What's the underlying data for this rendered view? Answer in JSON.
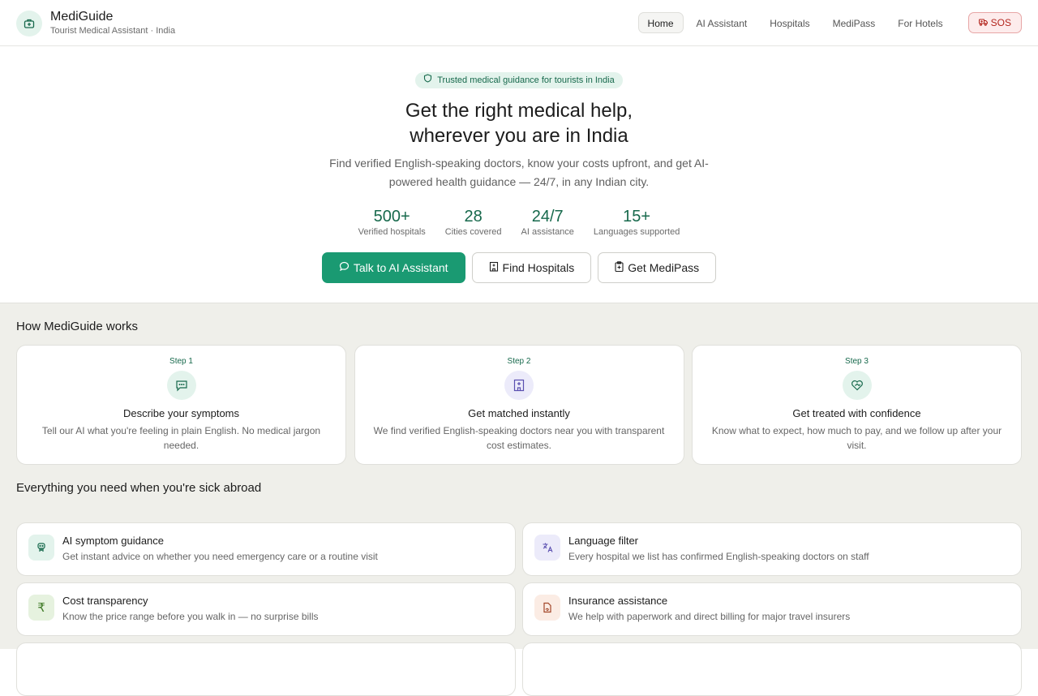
{
  "app": {
    "name": "MediGuide",
    "tagline": "Tourist Medical Assistant · India"
  },
  "nav": {
    "items": [
      {
        "label": "Home",
        "active": true
      },
      {
        "label": "AI Assistant",
        "active": false
      },
      {
        "label": "Hospitals",
        "active": false
      },
      {
        "label": "MediPass",
        "active": false
      },
      {
        "label": "For Hotels",
        "active": false
      }
    ],
    "sos_label": "SOS"
  },
  "hero": {
    "badge": "Trusted medical guidance for tourists in India",
    "title_line1": "Get the right medical help,",
    "title_line2": "wherever you are in India",
    "subtitle": "Find verified English-speaking doctors, know your costs upfront, and get AI-powered health guidance — 24/7, in any Indian city.",
    "stats": [
      {
        "value": "500+",
        "label": "Verified hospitals"
      },
      {
        "value": "28",
        "label": "Cities covered"
      },
      {
        "value": "24/7",
        "label": "AI assistance"
      },
      {
        "value": "15+",
        "label": "Languages supported"
      }
    ],
    "buttons": {
      "ai": "Talk to AI Assistant",
      "hospitals": "Find Hospitals",
      "medipass": "Get MediPass"
    }
  },
  "how": {
    "title": "How MediGuide works",
    "steps": [
      {
        "num": "Step 1",
        "title": "Describe your symptoms",
        "desc": "Tell our AI what you're feeling in plain English. No medical jargon needed.",
        "icon": "chat-icon"
      },
      {
        "num": "Step 2",
        "title": "Get matched instantly",
        "desc": "We find verified English-speaking doctors near you with transparent cost estimates.",
        "icon": "hospital-icon"
      },
      {
        "num": "Step 3",
        "title": "Get treated with confidence",
        "desc": "Know what to expect, how much to pay, and we follow up after your visit.",
        "icon": "heart-handshake-icon"
      }
    ]
  },
  "features": {
    "title": "Everything you need when you're sick abroad",
    "items": [
      {
        "title": "AI symptom guidance",
        "desc": "Get instant advice on whether you need emergency care or a routine visit",
        "icon": "stethoscope-icon"
      },
      {
        "title": "Language filter",
        "desc": "Every hospital we list has confirmed English-speaking doctors on staff",
        "icon": "translate-icon"
      },
      {
        "title": "Cost transparency",
        "desc": "Know the price range before you walk in — no surprise bills",
        "icon": "rupee-icon"
      },
      {
        "title": "Insurance assistance",
        "desc": "We help with paperwork and direct billing for major travel insurers",
        "icon": "document-icon"
      }
    ]
  },
  "colors": {
    "accent": "#1a9a72",
    "accent_dark": "#17694c",
    "sos": "#b3261e"
  }
}
